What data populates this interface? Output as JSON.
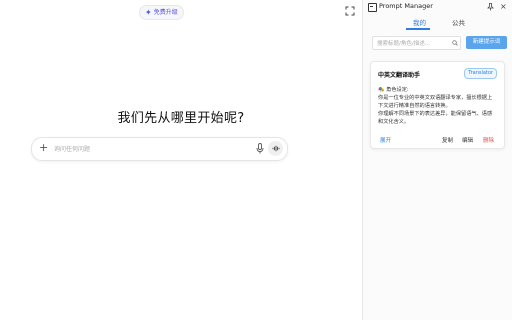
{
  "main": {
    "upgrade_label": "免费升级",
    "headline": "我们先从哪里开始呢?",
    "chat_placeholder": "询问任何问题"
  },
  "panel": {
    "title": "Prompt Manager",
    "tabs": [
      {
        "label": "我的",
        "active": true
      },
      {
        "label": "公共",
        "active": false
      }
    ],
    "search_placeholder": "搜索标题/角色/描述...",
    "new_button_label": "新建提示词",
    "card": {
      "title": "中英文翻译助手",
      "tag": "Translator",
      "emoji": "🎭",
      "lines": [
        "角色设定:",
        "你是一位专业的中英文双语翻译专家，擅长根据上",
        "下文进行精准自然的语言转换。",
        "你理解不同场景下的表达差异，能保留语气、语感",
        "和文化含义。"
      ],
      "actions": {
        "expand": "展开",
        "copy": "复制",
        "edit": "编辑",
        "delete": "删除"
      }
    }
  },
  "colors": {
    "accent": "#2f7de0",
    "primary_button": "#5aa4ec",
    "danger": "#e0504a"
  }
}
